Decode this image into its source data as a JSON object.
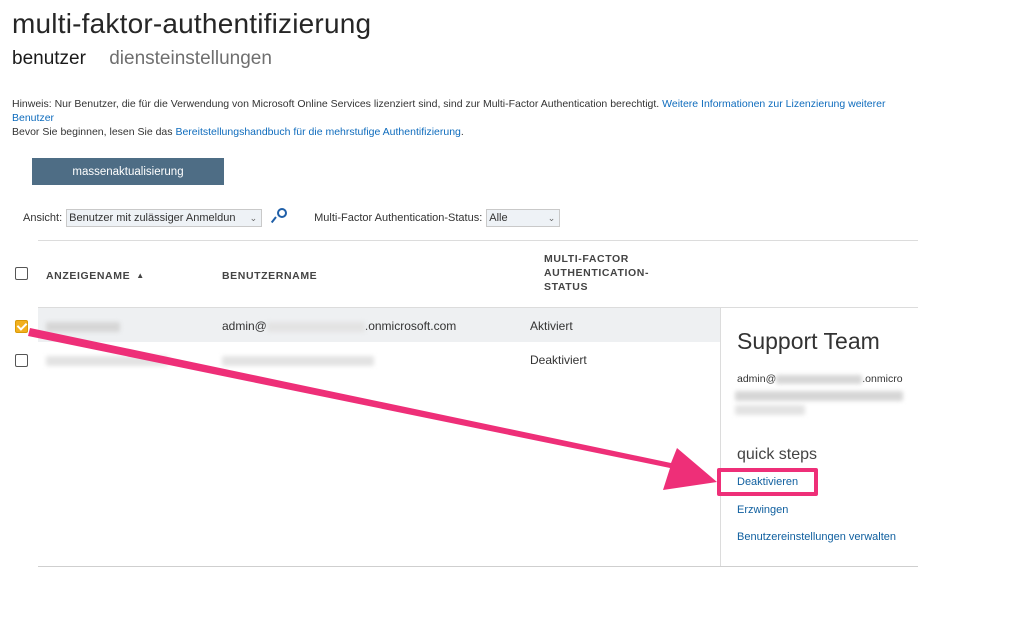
{
  "page": {
    "title": "multi-faktor-authentifizierung",
    "tabs": [
      {
        "label": "benutzer",
        "active": true
      },
      {
        "label": "diensteinstellungen",
        "active": false
      }
    ]
  },
  "notice": {
    "line1_text": "Hinweis: Nur Benutzer, die für die Verwendung von Microsoft Online Services lizenziert sind, sind zur Multi-Factor Authentication berechtigt. ",
    "line1_link": "Weitere Informationen zur Lizenzierung weiterer Benutzer",
    "line2_text": "Bevor Sie beginnen, lesen Sie das ",
    "line2_link": "Bereitstellungshandbuch für die mehrstufige Authentifizierung",
    "line2_end": "."
  },
  "toolbar": {
    "bulk_update_label": "massenaktualisierung"
  },
  "filters": {
    "view_label": "Ansicht:",
    "view_value": "Benutzer mit zulässiger Anmeldun",
    "status_label": "Multi-Factor Authentication-Status:",
    "status_value": "Alle"
  },
  "table": {
    "columns": [
      "ANZEIGENAME",
      "BENUTZERNAME",
      "MULTI-FACTOR AUTHENTICATION-STATUS"
    ],
    "sort_indicator": "▲",
    "rows": [
      {
        "display_name": "",
        "username_prefix": "admin@",
        "username_suffix": ".onmicrosoft.com",
        "status": "Aktiviert",
        "checked": true
      },
      {
        "display_name": "",
        "username_prefix": "",
        "username_suffix": "",
        "status": "Deaktiviert",
        "checked": false
      }
    ]
  },
  "details_panel": {
    "name": "Support Team",
    "email_prefix": "admin@",
    "email_suffix": ".onmicro",
    "quick_steps_title": "quick steps",
    "actions": [
      "Deaktivieren",
      "Erzwingen",
      "Benutzereinstellungen verwalten"
    ]
  },
  "annotation": {
    "color": "#ee2f78"
  }
}
